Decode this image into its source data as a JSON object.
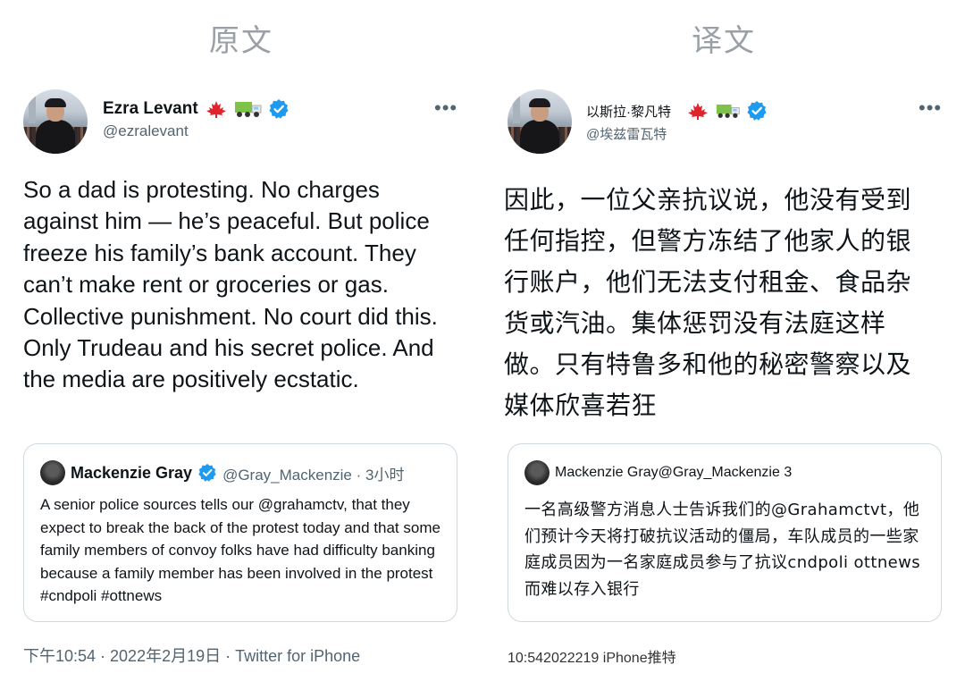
{
  "headings": {
    "original": "原文",
    "translation": "译文"
  },
  "original": {
    "author_name": "Ezra Levant",
    "author_handle": "@ezralevant",
    "tweet_text": "So a dad is protesting. No charges against him — he’s peaceful. But police freeze his family’s bank account. They can’t make rent or groceries or gas. Collective punishment. No court did this. Only Trudeau and his secret police. And the media are positively ecstatic.",
    "quoted": {
      "name": "Mackenzie Gray",
      "handle": "@Gray_Mackenzie · 3小时",
      "text": "A senior police sources tells our @grahamctv, that they expect to break the back of the protest today and that some family members of convoy folks have had difficulty banking because a family member has been involved in the  protest #cndpoli #ottnews"
    },
    "footer": "下午10:54 · 2022年2月19日 · Twitter for iPhone"
  },
  "translation": {
    "author_name": "以斯拉·黎凡特",
    "author_handle": "@埃兹雷瓦特",
    "tweet_text": "因此，一位父亲抗议说，他没有受到任何指控，但警方冻结了他家人的银行账户，他们无法支付租金、食品杂货或汽油。集体惩罚没有法庭这样做。只有特鲁多和他的秘密警察以及媒体欣喜若狂",
    "quoted": {
      "header": "Mackenzie Gray@Gray_Mackenzie 3",
      "text": "一名高级警方消息人士告诉我们的@Grahamctvt，他们预计今天将打破抗议活动的僵局，车队成员的一些家庭成员因为一名家庭成员参与了抗议cndpoli ottnews而难以存入银行"
    },
    "footer": "10:542022219 iPhone推特"
  },
  "icons": {
    "more": "•••",
    "flag": "maple-leaf-flag-icon",
    "truck": "truck-icon",
    "verified": "verified-badge-icon"
  },
  "colors": {
    "verified_blue": "#1d9bf0",
    "maple_red": "#e0242c",
    "muted_text": "#536471",
    "heading_gray": "#9aa0a6"
  }
}
